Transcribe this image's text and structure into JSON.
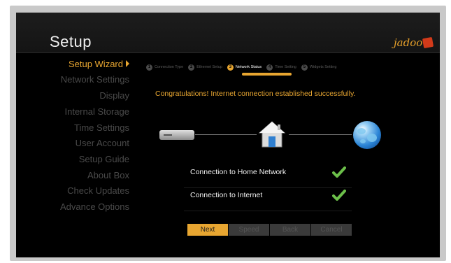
{
  "header": {
    "title": "Setup",
    "logo_text": "jadoo"
  },
  "sidebar": {
    "items": [
      {
        "label": "Setup Wizard",
        "active": true
      },
      {
        "label": "Network Settings"
      },
      {
        "label": "Display"
      },
      {
        "label": "Internal Storage"
      },
      {
        "label": "Time Settings"
      },
      {
        "label": "User Account"
      },
      {
        "label": "Setup Guide"
      },
      {
        "label": "About Box"
      },
      {
        "label": "Check Updates"
      },
      {
        "label": "Advance Options"
      }
    ]
  },
  "wizard": {
    "steps": [
      {
        "num": "1",
        "label": "Connection Type"
      },
      {
        "num": "2",
        "label": "Ethernet Setup"
      },
      {
        "num": "3",
        "label": "Network Status",
        "active": true
      },
      {
        "num": "4",
        "label": "Time Setting"
      },
      {
        "num": "5",
        "label": "Widgets Setting"
      }
    ],
    "message": "Congratulations! Internet connection established successfully.",
    "status": [
      {
        "label": "Connection to Home Network",
        "ok": true
      },
      {
        "label": "Connection to Internet",
        "ok": true
      }
    ]
  },
  "buttons": {
    "next": "Next",
    "speed": "Speed",
    "back": "Back",
    "cancel": "Cancel"
  },
  "colors": {
    "accent": "#e8a631",
    "check": "#6cc04a",
    "background": "#000000"
  },
  "icons": {
    "router": "router-icon",
    "home": "home-icon",
    "internet": "globe-icon",
    "check": "check-icon"
  }
}
